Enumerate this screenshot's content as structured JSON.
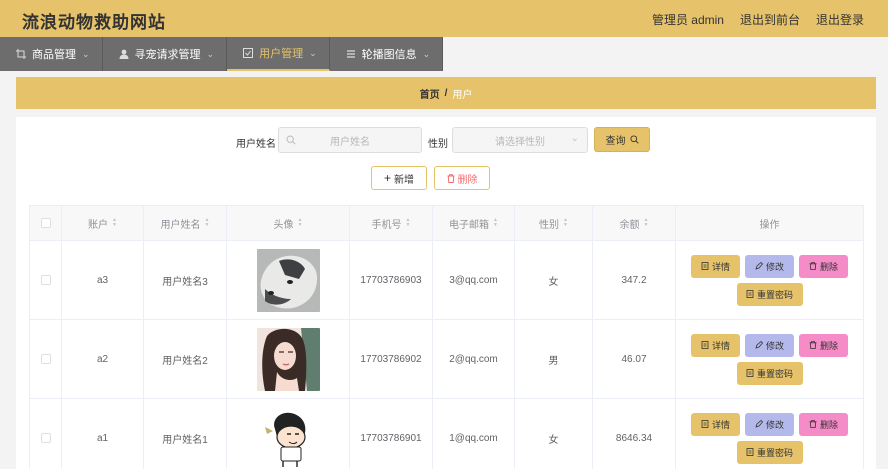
{
  "header": {
    "site_title": "流浪动物救助网站",
    "user_label": "管理员 admin",
    "front_link": "退出到前台",
    "logout_link": "退出登录"
  },
  "nav": {
    "items": [
      {
        "label": "商品管理",
        "icon": "crop-icon"
      },
      {
        "label": "寻宠请求管理",
        "icon": "user-icon"
      },
      {
        "label": "用户管理",
        "icon": "check-square-icon",
        "active": true
      },
      {
        "label": "轮播图信息",
        "icon": "menu-icon"
      }
    ]
  },
  "breadcrumb": {
    "home": "首页",
    "separator": "/",
    "current": "用户"
  },
  "search": {
    "name_label": "用户姓名",
    "name_placeholder": "用户姓名",
    "gender_label": "性别",
    "gender_placeholder": "请选择性别",
    "query_button": "查询"
  },
  "actions": {
    "add_button": "新增",
    "delete_button": "删除"
  },
  "table": {
    "columns": [
      "账户",
      "用户姓名",
      "头像",
      "手机号",
      "电子邮箱",
      "性别",
      "余额",
      "操作"
    ],
    "rows": [
      {
        "account": "a3",
        "name": "用户姓名3",
        "avatar": "husky-photo",
        "phone": "17703786903",
        "email": "3@qq.com",
        "gender": "女",
        "balance": "347.2"
      },
      {
        "account": "a2",
        "name": "用户姓名2",
        "avatar": "girl-illustration",
        "phone": "17703786902",
        "email": "2@qq.com",
        "gender": "男",
        "balance": "46.07"
      },
      {
        "account": "a1",
        "name": "用户姓名1",
        "avatar": "cartoon-boy",
        "phone": "17703786901",
        "email": "1@qq.com",
        "gender": "女",
        "balance": "8646.34"
      }
    ],
    "row_actions": {
      "detail": "详情",
      "edit": "修改",
      "remove": "删除",
      "reset_password": "重置密码"
    }
  },
  "colors": {
    "accent": "#e6c36a",
    "nav_bg": "#6d6d6d",
    "edit": "#b4b9eb",
    "remove": "#f58cc8"
  }
}
